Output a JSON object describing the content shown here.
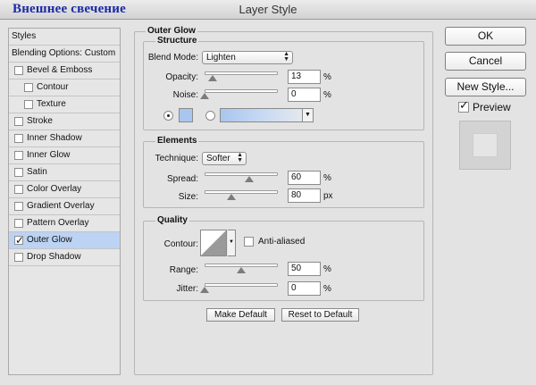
{
  "window": {
    "overlay_title": "Внешнее свечение",
    "title": "Layer Style"
  },
  "styles_panel": {
    "header": "Styles",
    "blending": "Blending Options: Custom",
    "items": [
      {
        "label": "Bevel & Emboss",
        "checked": false
      },
      {
        "label": "Contour",
        "checked": false
      },
      {
        "label": "Texture",
        "checked": false
      },
      {
        "label": "Stroke",
        "checked": false
      },
      {
        "label": "Inner Shadow",
        "checked": false
      },
      {
        "label": "Inner Glow",
        "checked": false
      },
      {
        "label": "Satin",
        "checked": false
      },
      {
        "label": "Color Overlay",
        "checked": false
      },
      {
        "label": "Gradient Overlay",
        "checked": false
      },
      {
        "label": "Pattern Overlay",
        "checked": false
      },
      {
        "label": "Outer Glow",
        "checked": true,
        "selected": true
      },
      {
        "label": "Drop Shadow",
        "checked": false
      }
    ]
  },
  "outer_glow": {
    "title": "Outer Glow",
    "structure": {
      "title": "Structure",
      "blend_mode_label": "Blend Mode:",
      "blend_mode_value": "Lighten",
      "opacity_label": "Opacity:",
      "opacity_value": "13",
      "noise_label": "Noise:",
      "noise_value": "0",
      "percent": "%",
      "glow_color": "#a9c6ee"
    },
    "elements": {
      "title": "Elements",
      "technique_label": "Technique:",
      "technique_value": "Softer",
      "spread_label": "Spread:",
      "spread_value": "60",
      "size_label": "Size:",
      "size_value": "80",
      "percent": "%",
      "px": "px"
    },
    "quality": {
      "title": "Quality",
      "contour_label": "Contour:",
      "anti_aliased_label": "Anti-aliased",
      "range_label": "Range:",
      "range_value": "50",
      "jitter_label": "Jitter:",
      "jitter_value": "0",
      "percent": "%"
    },
    "make_default": "Make Default",
    "reset_default": "Reset to Default"
  },
  "buttons": {
    "ok": "OK",
    "cancel": "Cancel",
    "new_style": "New Style...",
    "preview_label": "Preview"
  }
}
